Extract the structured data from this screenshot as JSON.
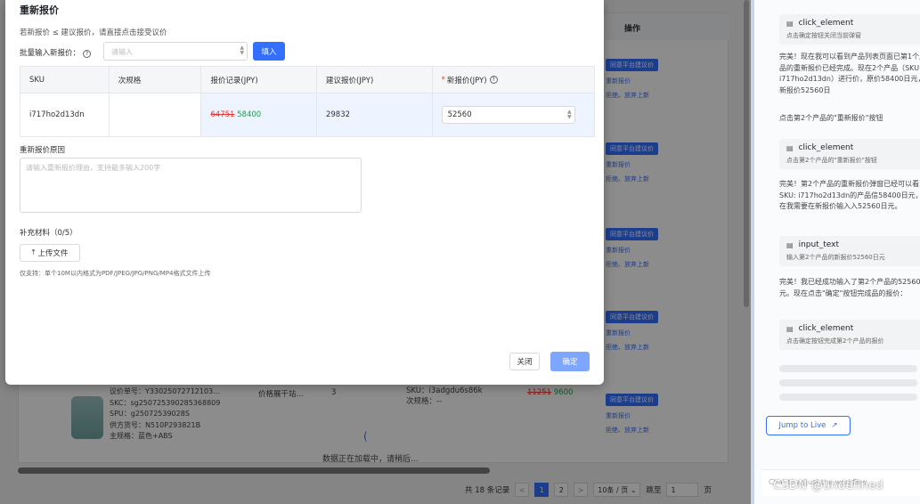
{
  "modal": {
    "title": "重新报价",
    "hint": "若新报价 ≤ 建议报价，请直接点击接受议价",
    "batch_label": "批量输入新报价：",
    "batch_placeholder": "请输入",
    "fill_button": "填入",
    "table": {
      "headers": [
        "SKU",
        "次规格",
        "报价记录(JPY)",
        "建议报价(JPY)",
        "新报价(JPY)"
      ],
      "row": {
        "sku": "i717ho2d13dn",
        "spec": "",
        "price_old": "64751",
        "price_record": "58400",
        "suggested": "29832",
        "new_price": "52560"
      }
    },
    "reason_label": "重新报价原因",
    "reason_placeholder": "请输入重新报价理由，支持最多输入200字",
    "supp_label": "补充材料（0/5）",
    "upload_button": "上传文件",
    "support_note": "仅支持：单个10M以内格式为PDF/JPEG/JPG/PNG/MP4格式文件上传",
    "close_button": "关闭",
    "ok_button": "确定"
  },
  "background": {
    "ops_header": "操作",
    "op_primary": "同意平台建议价",
    "op_link1": "重新报价",
    "op_link2": "拒绝、放弃上新",
    "product": {
      "line1": "议价单号：Y33025072712103...",
      "line2": "SKC：sg250725390285368809",
      "line3": "SPU：g25072539028S",
      "line4": "供方货号：N510P293821B",
      "line5": "主规格：蓝色+ABS"
    },
    "cell_title": "价格展干站...",
    "cell_qty": "3",
    "cell_sku": "SKU：i3adgdu6s86k",
    "cell_spec": "次规格：--",
    "cell_price_old": "11251",
    "cell_price_new": "9600",
    "loading": "数据正在加载中，请稍后...",
    "pager": {
      "total": "共 18 条记录",
      "prev": "<",
      "page1": "1",
      "page2": "2",
      "next": ">",
      "size": "10条 / 页",
      "goto": "跳至",
      "goto_value": "1",
      "page_unit": "页"
    }
  },
  "panel": {
    "steps": [
      {
        "title": "click_element",
        "desc": "点击确定按钮关闭当前弹窗"
      },
      {
        "title": "click_element",
        "desc": "点击第2个产品的\"重新报价\"按钮"
      },
      {
        "title": "input_text",
        "desc": "输入第2个产品的新报价52560日元"
      },
      {
        "title": "click_element",
        "desc": "点击确定按钮完成第2个产品的报价"
      }
    ],
    "msg1": "完美！现在我可以看到产品列表页面已第1个产品的重新报价已经完成。现在2个产品（SKU: i717ho2d13dn）进行价，原价58400日元，新报价52560日",
    "msg2": "点击第2个产品的\"重新报价\"按钮",
    "msg3": "完美！第2个产品的重新报价弹窗已经可以看到SKU: i717ho2d13dn的产品信58400日元，现在我需要在新报价输入入52560日元。",
    "msg4": "完美！我已经成功输入了第2个产品的52560日元。现在点击\"确定\"按钮完成品的报价：",
    "jump_button": "Jump to Live",
    "chat_placeholder": "Chat to adjust the workflow"
  },
  "watermark": "CSDN @undefined"
}
